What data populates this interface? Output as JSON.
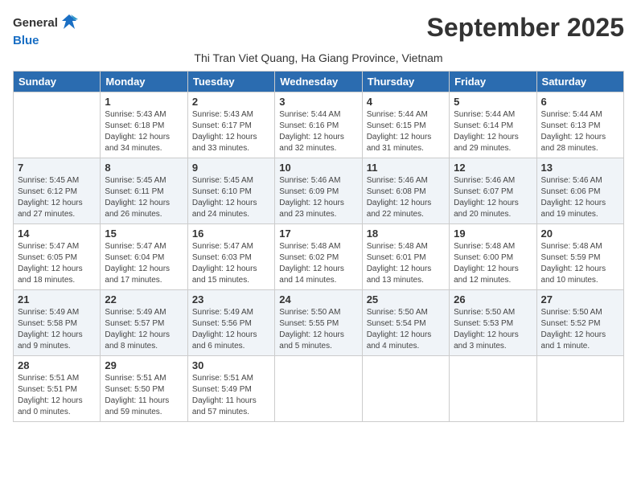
{
  "header": {
    "logo_general": "General",
    "logo_blue": "Blue",
    "title": "September 2025",
    "subtitle": "Thi Tran Viet Quang, Ha Giang Province, Vietnam"
  },
  "weekdays": [
    "Sunday",
    "Monday",
    "Tuesday",
    "Wednesday",
    "Thursday",
    "Friday",
    "Saturday"
  ],
  "weeks": [
    [
      {
        "day": "",
        "info": ""
      },
      {
        "day": "1",
        "info": "Sunrise: 5:43 AM\nSunset: 6:18 PM\nDaylight: 12 hours\nand 34 minutes."
      },
      {
        "day": "2",
        "info": "Sunrise: 5:43 AM\nSunset: 6:17 PM\nDaylight: 12 hours\nand 33 minutes."
      },
      {
        "day": "3",
        "info": "Sunrise: 5:44 AM\nSunset: 6:16 PM\nDaylight: 12 hours\nand 32 minutes."
      },
      {
        "day": "4",
        "info": "Sunrise: 5:44 AM\nSunset: 6:15 PM\nDaylight: 12 hours\nand 31 minutes."
      },
      {
        "day": "5",
        "info": "Sunrise: 5:44 AM\nSunset: 6:14 PM\nDaylight: 12 hours\nand 29 minutes."
      },
      {
        "day": "6",
        "info": "Sunrise: 5:44 AM\nSunset: 6:13 PM\nDaylight: 12 hours\nand 28 minutes."
      }
    ],
    [
      {
        "day": "7",
        "info": "Sunrise: 5:45 AM\nSunset: 6:12 PM\nDaylight: 12 hours\nand 27 minutes."
      },
      {
        "day": "8",
        "info": "Sunrise: 5:45 AM\nSunset: 6:11 PM\nDaylight: 12 hours\nand 26 minutes."
      },
      {
        "day": "9",
        "info": "Sunrise: 5:45 AM\nSunset: 6:10 PM\nDaylight: 12 hours\nand 24 minutes."
      },
      {
        "day": "10",
        "info": "Sunrise: 5:46 AM\nSunset: 6:09 PM\nDaylight: 12 hours\nand 23 minutes."
      },
      {
        "day": "11",
        "info": "Sunrise: 5:46 AM\nSunset: 6:08 PM\nDaylight: 12 hours\nand 22 minutes."
      },
      {
        "day": "12",
        "info": "Sunrise: 5:46 AM\nSunset: 6:07 PM\nDaylight: 12 hours\nand 20 minutes."
      },
      {
        "day": "13",
        "info": "Sunrise: 5:46 AM\nSunset: 6:06 PM\nDaylight: 12 hours\nand 19 minutes."
      }
    ],
    [
      {
        "day": "14",
        "info": "Sunrise: 5:47 AM\nSunset: 6:05 PM\nDaylight: 12 hours\nand 18 minutes."
      },
      {
        "day": "15",
        "info": "Sunrise: 5:47 AM\nSunset: 6:04 PM\nDaylight: 12 hours\nand 17 minutes."
      },
      {
        "day": "16",
        "info": "Sunrise: 5:47 AM\nSunset: 6:03 PM\nDaylight: 12 hours\nand 15 minutes."
      },
      {
        "day": "17",
        "info": "Sunrise: 5:48 AM\nSunset: 6:02 PM\nDaylight: 12 hours\nand 14 minutes."
      },
      {
        "day": "18",
        "info": "Sunrise: 5:48 AM\nSunset: 6:01 PM\nDaylight: 12 hours\nand 13 minutes."
      },
      {
        "day": "19",
        "info": "Sunrise: 5:48 AM\nSunset: 6:00 PM\nDaylight: 12 hours\nand 12 minutes."
      },
      {
        "day": "20",
        "info": "Sunrise: 5:48 AM\nSunset: 5:59 PM\nDaylight: 12 hours\nand 10 minutes."
      }
    ],
    [
      {
        "day": "21",
        "info": "Sunrise: 5:49 AM\nSunset: 5:58 PM\nDaylight: 12 hours\nand 9 minutes."
      },
      {
        "day": "22",
        "info": "Sunrise: 5:49 AM\nSunset: 5:57 PM\nDaylight: 12 hours\nand 8 minutes."
      },
      {
        "day": "23",
        "info": "Sunrise: 5:49 AM\nSunset: 5:56 PM\nDaylight: 12 hours\nand 6 minutes."
      },
      {
        "day": "24",
        "info": "Sunrise: 5:50 AM\nSunset: 5:55 PM\nDaylight: 12 hours\nand 5 minutes."
      },
      {
        "day": "25",
        "info": "Sunrise: 5:50 AM\nSunset: 5:54 PM\nDaylight: 12 hours\nand 4 minutes."
      },
      {
        "day": "26",
        "info": "Sunrise: 5:50 AM\nSunset: 5:53 PM\nDaylight: 12 hours\nand 3 minutes."
      },
      {
        "day": "27",
        "info": "Sunrise: 5:50 AM\nSunset: 5:52 PM\nDaylight: 12 hours\nand 1 minute."
      }
    ],
    [
      {
        "day": "28",
        "info": "Sunrise: 5:51 AM\nSunset: 5:51 PM\nDaylight: 12 hours\nand 0 minutes."
      },
      {
        "day": "29",
        "info": "Sunrise: 5:51 AM\nSunset: 5:50 PM\nDaylight: 11 hours\nand 59 minutes."
      },
      {
        "day": "30",
        "info": "Sunrise: 5:51 AM\nSunset: 5:49 PM\nDaylight: 11 hours\nand 57 minutes."
      },
      {
        "day": "",
        "info": ""
      },
      {
        "day": "",
        "info": ""
      },
      {
        "day": "",
        "info": ""
      },
      {
        "day": "",
        "info": ""
      }
    ]
  ]
}
